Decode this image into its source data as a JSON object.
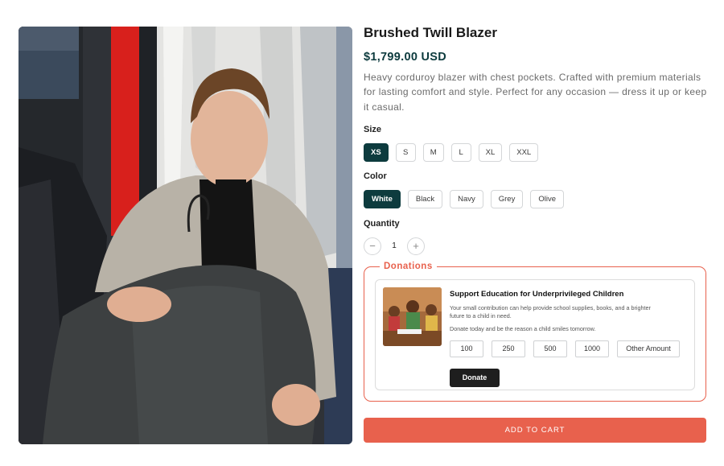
{
  "product": {
    "image_alt": "Man holding a grey blazer in a clothing store",
    "title": "Brushed Twill Blazer",
    "price": "$1,799.00 USD",
    "description": "Heavy corduroy blazer with chest pockets. Crafted with premium materials for lasting comfort and style. Perfect for any occasion — dress it up or keep it casual."
  },
  "options": {
    "size_label": "Size",
    "sizes": [
      "XS",
      "S",
      "M",
      "L",
      "XL",
      "XXL"
    ],
    "selected_size": "XS",
    "color_label": "Color",
    "colors": [
      "White",
      "Black",
      "Navy",
      "Grey",
      "Olive"
    ],
    "selected_color": "White"
  },
  "quantity": {
    "label": "Quantity",
    "value": "1",
    "decrement": "−",
    "increment": "+"
  },
  "donations": {
    "legend": "Donations",
    "card_title": "Support Education for Underprivileged Children",
    "card_text": "Your small contribution can help provide school supplies, books, and a brighter future to a child in need.",
    "card_text2": "Donate today and be the reason a child smiles tomorrow.",
    "amounts": [
      "100",
      "250",
      "500",
      "1000",
      "Other Amount"
    ],
    "donate_label": "Donate"
  },
  "cart": {
    "add_label": "ADD TO CART"
  },
  "colors": {
    "brand_dark": "#0d3b3e",
    "accent": "#e8614d"
  }
}
